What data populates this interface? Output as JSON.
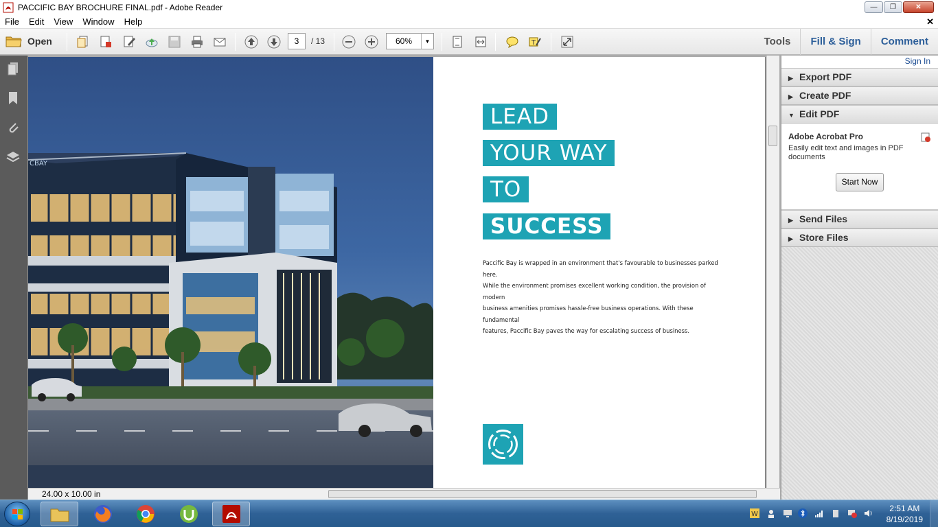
{
  "window": {
    "title": "PACCIFIC BAY BROCHURE FINAL.pdf - Adobe Reader",
    "minimize": "—",
    "maximize": "❐",
    "close": "✕"
  },
  "menu": {
    "items": [
      "File",
      "Edit",
      "View",
      "Window",
      "Help"
    ],
    "close_doc": "✕"
  },
  "toolbar": {
    "open_label": "Open",
    "current_page": "3",
    "total_pages": "/ 13",
    "zoom": "60%"
  },
  "right_tabs": {
    "tools": "Tools",
    "fill_sign": "Fill & Sign",
    "comment": "Comment"
  },
  "document": {
    "headline": [
      "LEAD",
      "YOUR WAY",
      "TO",
      "SUCCESS"
    ],
    "building_sign": "CBAY",
    "body_lines": [
      "Paccific Bay is wrapped in an environment that's favourable to businesses parked here.",
      "While the environment promises excellent working condition, the provision of modern",
      "business amenities promises hassle-free business operations. With these fundamental",
      "features, Paccific Bay paves the way for escalating success of business."
    ],
    "accent_color": "#1ea3b4"
  },
  "status": {
    "page_size": "24.00 x 10.00 in"
  },
  "task_pane": {
    "sign_in": "Sign In",
    "sections": {
      "export_pdf": "Export PDF",
      "create_pdf": "Create PDF",
      "edit_pdf": "Edit PDF",
      "send_files": "Send Files",
      "store_files": "Store Files"
    },
    "edit_pdf_title": "Adobe Acrobat Pro",
    "edit_pdf_desc": "Easily edit text and images in PDF documents",
    "start_now": "Start Now"
  },
  "taskbar": {
    "time": "2:51 AM",
    "date": "8/19/2019"
  }
}
